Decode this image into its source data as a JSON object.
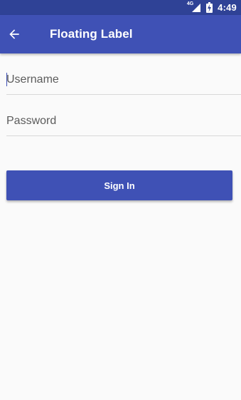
{
  "status_bar": {
    "network_type": "4G",
    "time": "4:49",
    "signal_icon": "cellular-signal-icon",
    "battery_icon": "battery-charging-icon"
  },
  "app_bar": {
    "title": "Floating Label",
    "back_icon": "arrow-back-icon"
  },
  "form": {
    "username": {
      "placeholder": "Username",
      "value": ""
    },
    "password": {
      "placeholder": "Password",
      "value": ""
    },
    "submit_label": "Sign In"
  },
  "colors": {
    "primary": "#3f51b5",
    "primary_dark": "#2f4296",
    "background": "#fafafa",
    "on_primary": "#ffffff"
  }
}
